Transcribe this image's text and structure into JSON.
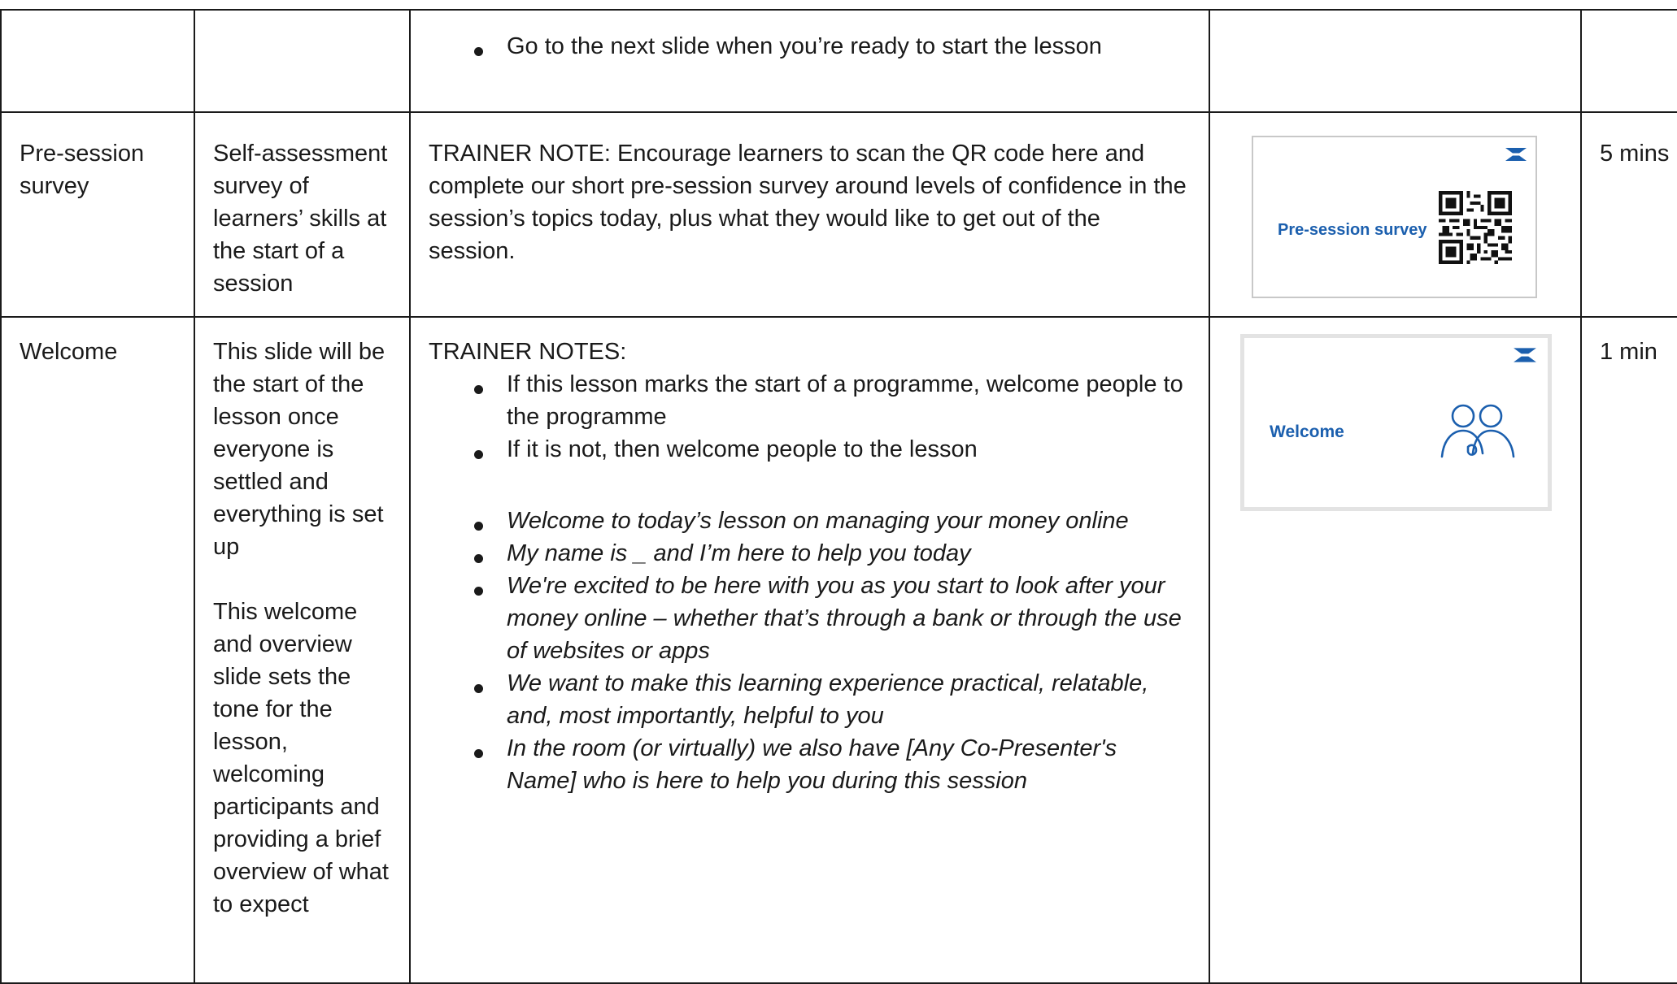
{
  "rows": [
    {
      "col1": "",
      "col2": "",
      "bullets": [
        "Go to the next slide when you’re ready to start the lesson"
      ],
      "time": ""
    },
    {
      "col1": "Pre-session survey",
      "col2": "Self-assessment survey of learners’ skills at the start of a session",
      "note": "TRAINER NOTE: Encourage learners to scan the QR code here and complete our short pre-session survey around levels of confidence in the session’s topics today, plus what they would like to get out of the session.",
      "slide": {
        "title": "Pre-session survey",
        "logo_icon": "halifax-logo-icon",
        "graphic_icon": "qr-code-icon"
      },
      "time": "5 mins"
    },
    {
      "col1": "Welcome",
      "col2_p1": "This slide will be the start of the lesson once everyone is settled and everything is set up",
      "col2_p2": "This welcome and overview slide sets the tone for the lesson, welcoming participants and providing a brief overview of what to expect",
      "notes_heading": "TRAINER NOTES:",
      "bullets": [
        "If this lesson marks the start of a programme, welcome people to the programme",
        "If it is not, then welcome people to the lesson"
      ],
      "script_bullets": [
        "Welcome to today’s lesson on managing your money online",
        "My name is _ and I’m here to help you today",
        "We're excited to be here with you as you start to look after your money online – whether that’s through a bank or through the use of websites or apps",
        "We want to make this learning experience practical, relatable, and, most importantly, helpful to you",
        "In the room (or virtually) we also have [Any Co-Presenter's Name] who is here to help you during this session"
      ],
      "slide": {
        "title": "Welcome",
        "logo_icon": "halifax-logo-icon",
        "graphic_icon": "people-icon"
      },
      "time": "1 min"
    }
  ],
  "colors": {
    "text": "#1a1a1a",
    "border": "#1a1a1a",
    "slide_title": "#1b5fae",
    "logo_blue": "#1b5fae"
  }
}
